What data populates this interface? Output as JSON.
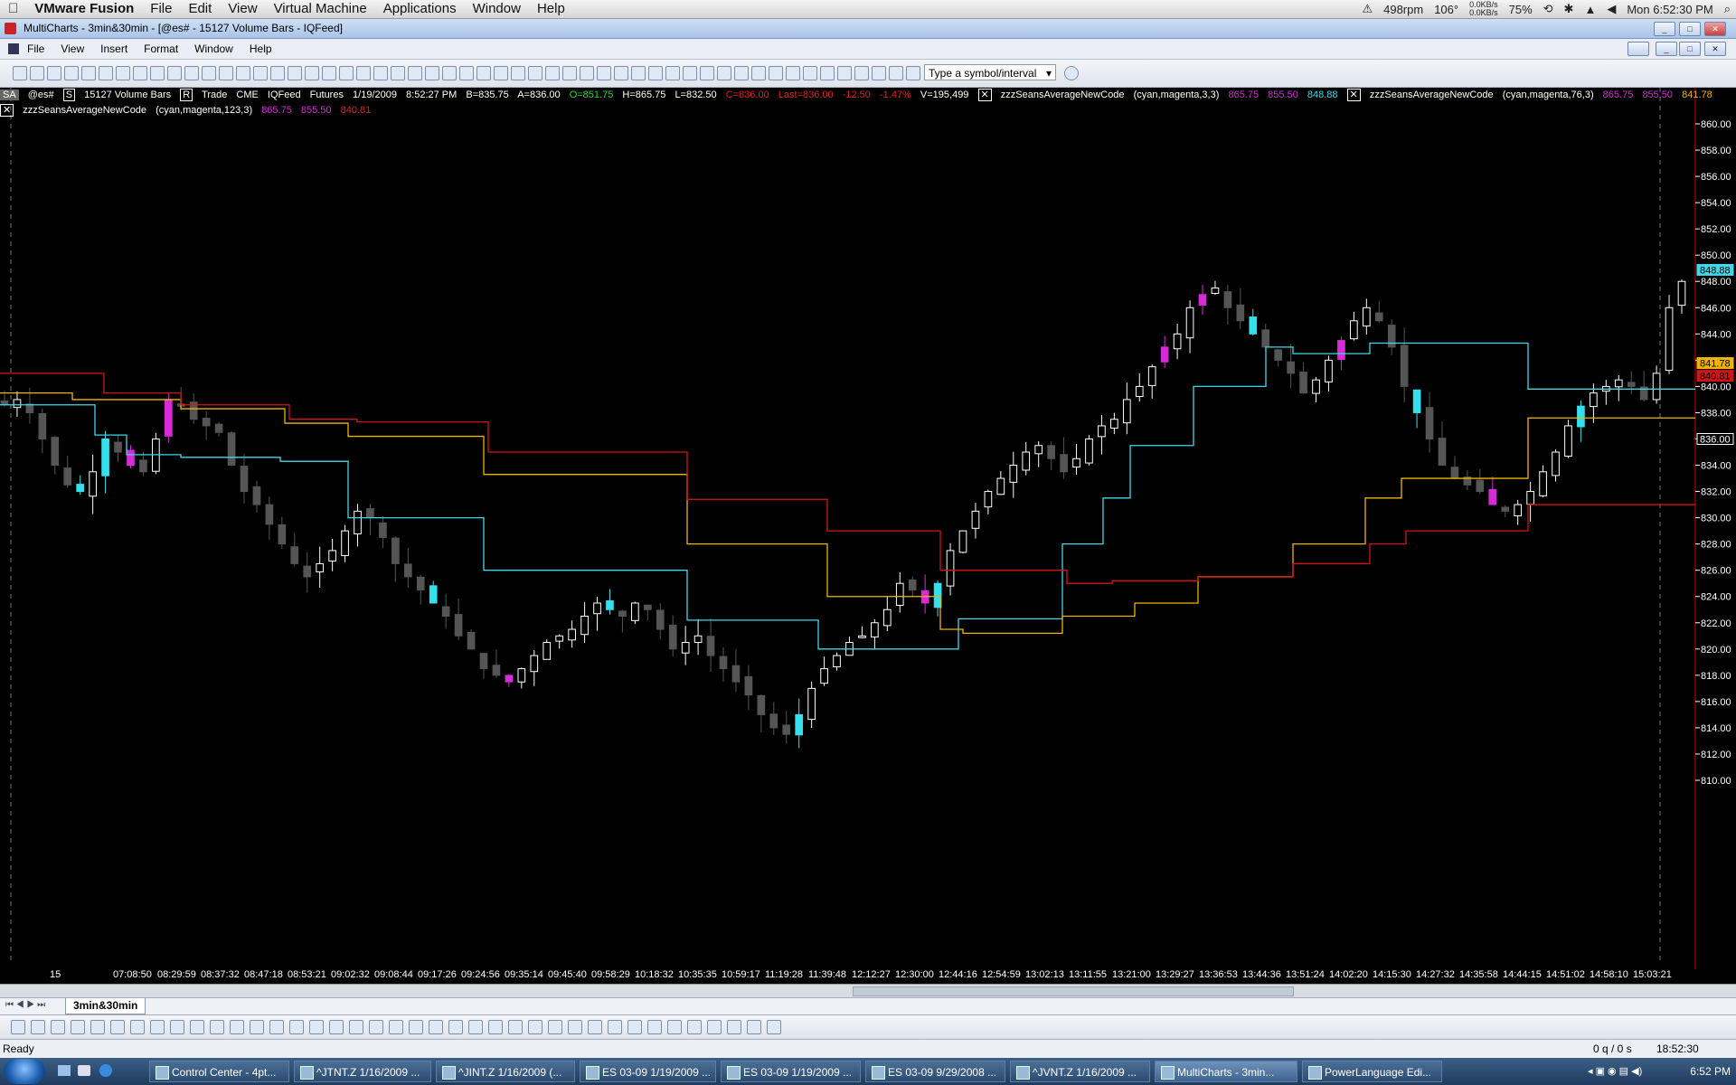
{
  "macmenubar": {
    "apple": "",
    "app_name": "VMware Fusion",
    "menus": [
      "File",
      "Edit",
      "View",
      "Virtual Machine",
      "Applications",
      "Window",
      "Help"
    ],
    "status": {
      "fan": "498rpm",
      "temp": "106°",
      "net_up": "0.0KB/s",
      "net_down": "0.0KB/s",
      "battery": "75%",
      "clock": "Mon 6:52:30 PM"
    }
  },
  "window": {
    "title": "MultiCharts - 3min&30min - [@es# - 15127 Volume Bars - IQFeed]"
  },
  "app_menu": [
    "File",
    "View",
    "Insert",
    "Format",
    "Window",
    "Help"
  ],
  "toolbar": {
    "symbol_placeholder": "Type a symbol/interval"
  },
  "status_line1": {
    "sa": "SA",
    "symbol": "@es#",
    "s_btn": "S",
    "interval": "15127 Volume Bars",
    "r_btn": "R",
    "trade": "Trade",
    "exchange": "CME",
    "feed": "IQFeed",
    "type": "Futures",
    "date": "1/19/2009",
    "time": "8:52:27 PM",
    "bid": "B=835.75",
    "ask": "A=836.00",
    "open": "O=851.75",
    "high": "H=865.75",
    "low": "L=832.50",
    "close": "C=836.00",
    "last": "Last=836.00",
    "chg": "-12.50",
    "chg_pct": "-1.47%",
    "volume": "V=195,499",
    "ind1_name": "zzzSeansAverageNewCode",
    "ind1_params": "(cyan,magenta,3,3)",
    "ind1_v1": "865.75",
    "ind1_v2": "855.50",
    "ind1_v3": "848.88",
    "ind2_name": "zzzSeansAverageNewCode",
    "ind2_params": "(cyan,magenta,76,3)",
    "ind2_v1": "865.75",
    "ind2_v2": "855.50",
    "ind2_v3": "841.78"
  },
  "status_line2": {
    "ind3_name": "zzzSeansAverageNewCode",
    "ind3_params": "(cyan,magenta,123,3)",
    "ind3_v1": "865.75",
    "ind3_v2": "855.50",
    "ind3_v3": "840.81"
  },
  "colors": {
    "cyan_line": "#3fd8e8",
    "yellow_line": "#f0b400",
    "red_line": "#d41414",
    "candle_up": "#ffffff",
    "candle_down": "#555555",
    "magenta_candle": "#d62bd6",
    "cyan_candle": "#34e0ee"
  },
  "chart_data": {
    "type": "candlestick",
    "y_ticks": [
      "860.00",
      "858.00",
      "856.00",
      "854.00",
      "852.00",
      "850.00",
      "848.00",
      "846.00",
      "844.00",
      "842.00",
      "840.00",
      "838.00",
      "836.00",
      "834.00",
      "832.00",
      "830.00",
      "828.00",
      "826.00",
      "824.00",
      "822.00",
      "820.00",
      "818.00",
      "816.00",
      "814.00",
      "812.00",
      "810.00"
    ],
    "ylim": [
      809,
      861.5
    ],
    "x_ticks": [
      "15",
      "07:08:50",
      "08:29:59",
      "08:37:32",
      "08:47:18",
      "08:53:21",
      "09:02:32",
      "09:08:44",
      "09:17:26",
      "09:24:56",
      "09:35:14",
      "09:45:40",
      "09:58:29",
      "10:18:32",
      "10:35:35",
      "10:59:17",
      "11:19:28",
      "11:39:48",
      "12:12:27",
      "12:30:00",
      "12:44:16",
      "12:54:59",
      "13:02:13",
      "13:11:55",
      "13:21:00",
      "13:29:27",
      "13:36:53",
      "13:44:36",
      "13:51:24",
      "14:02:20",
      "14:15:30",
      "14:27:32",
      "14:35:58",
      "14:44:15",
      "14:51:02",
      "14:58:10",
      "15:03:21"
    ],
    "price_labels": [
      {
        "value": "848.88",
        "color": "#3fd8e8"
      },
      {
        "value": "841.78",
        "color": "#f0b400"
      },
      {
        "value": "840.81",
        "color": "#d41414"
      },
      {
        "value": "836.00",
        "color": "#ffffff"
      }
    ],
    "close_path": [
      838.6,
      839,
      838,
      836,
      834,
      832.5,
      832,
      833.5,
      836,
      835,
      834,
      833.5,
      836,
      839,
      838.5,
      837.5,
      837,
      836.5,
      834,
      832,
      831,
      829.5,
      828,
      826.5,
      825.5,
      826.5,
      827.5,
      829,
      830.5,
      830,
      828.5,
      826.5,
      825.5,
      824.5,
      823.5,
      822.5,
      821,
      820,
      818.5,
      818,
      817.5,
      818.5,
      819.5,
      820.5,
      821,
      821.5,
      822.5,
      823.5,
      823,
      822.5,
      823.5,
      823,
      821.5,
      820,
      820.5,
      821,
      819.5,
      818.5,
      817.5,
      816.5,
      815,
      814,
      813.5,
      815,
      817,
      818.5,
      819.5,
      820.5,
      821,
      822,
      823,
      825,
      824.5,
      823.5,
      825,
      827.5,
      829,
      830.5,
      832,
      833,
      834,
      835,
      835.5,
      834.5,
      833.5,
      834.5,
      836,
      837,
      837.5,
      839,
      840,
      841.5,
      843,
      844,
      846,
      847,
      847.5,
      846,
      845,
      844,
      843,
      842,
      841,
      839.5,
      840.5,
      842,
      843.5,
      845,
      846,
      845,
      843,
      840,
      838,
      836,
      834,
      833,
      832.5,
      832,
      831,
      830.5,
      831,
      832,
      833.5,
      835,
      837,
      838.5,
      839.5,
      840,
      840.5,
      840,
      839,
      841,
      846,
      848
    ]
  },
  "tabs": [
    "3min&30min"
  ],
  "statusbar": {
    "left": "Ready",
    "queue": "0 q / 0 s",
    "time": "18:52:30"
  },
  "taskbar": {
    "items": [
      "Control Center - 4pt...",
      "^JTNT.Z 1/16/2009 ...",
      "^JINT.Z 1/16/2009 (...",
      "ES 03-09 1/19/2009 ...",
      "ES 03-09 1/19/2009 ...",
      "ES 03-09 9/29/2008 ...",
      "^JVNT.Z 1/16/2009 ...",
      "MultiCharts - 3min...",
      "PowerLanguage Edi..."
    ],
    "clock": "6:52 PM"
  }
}
